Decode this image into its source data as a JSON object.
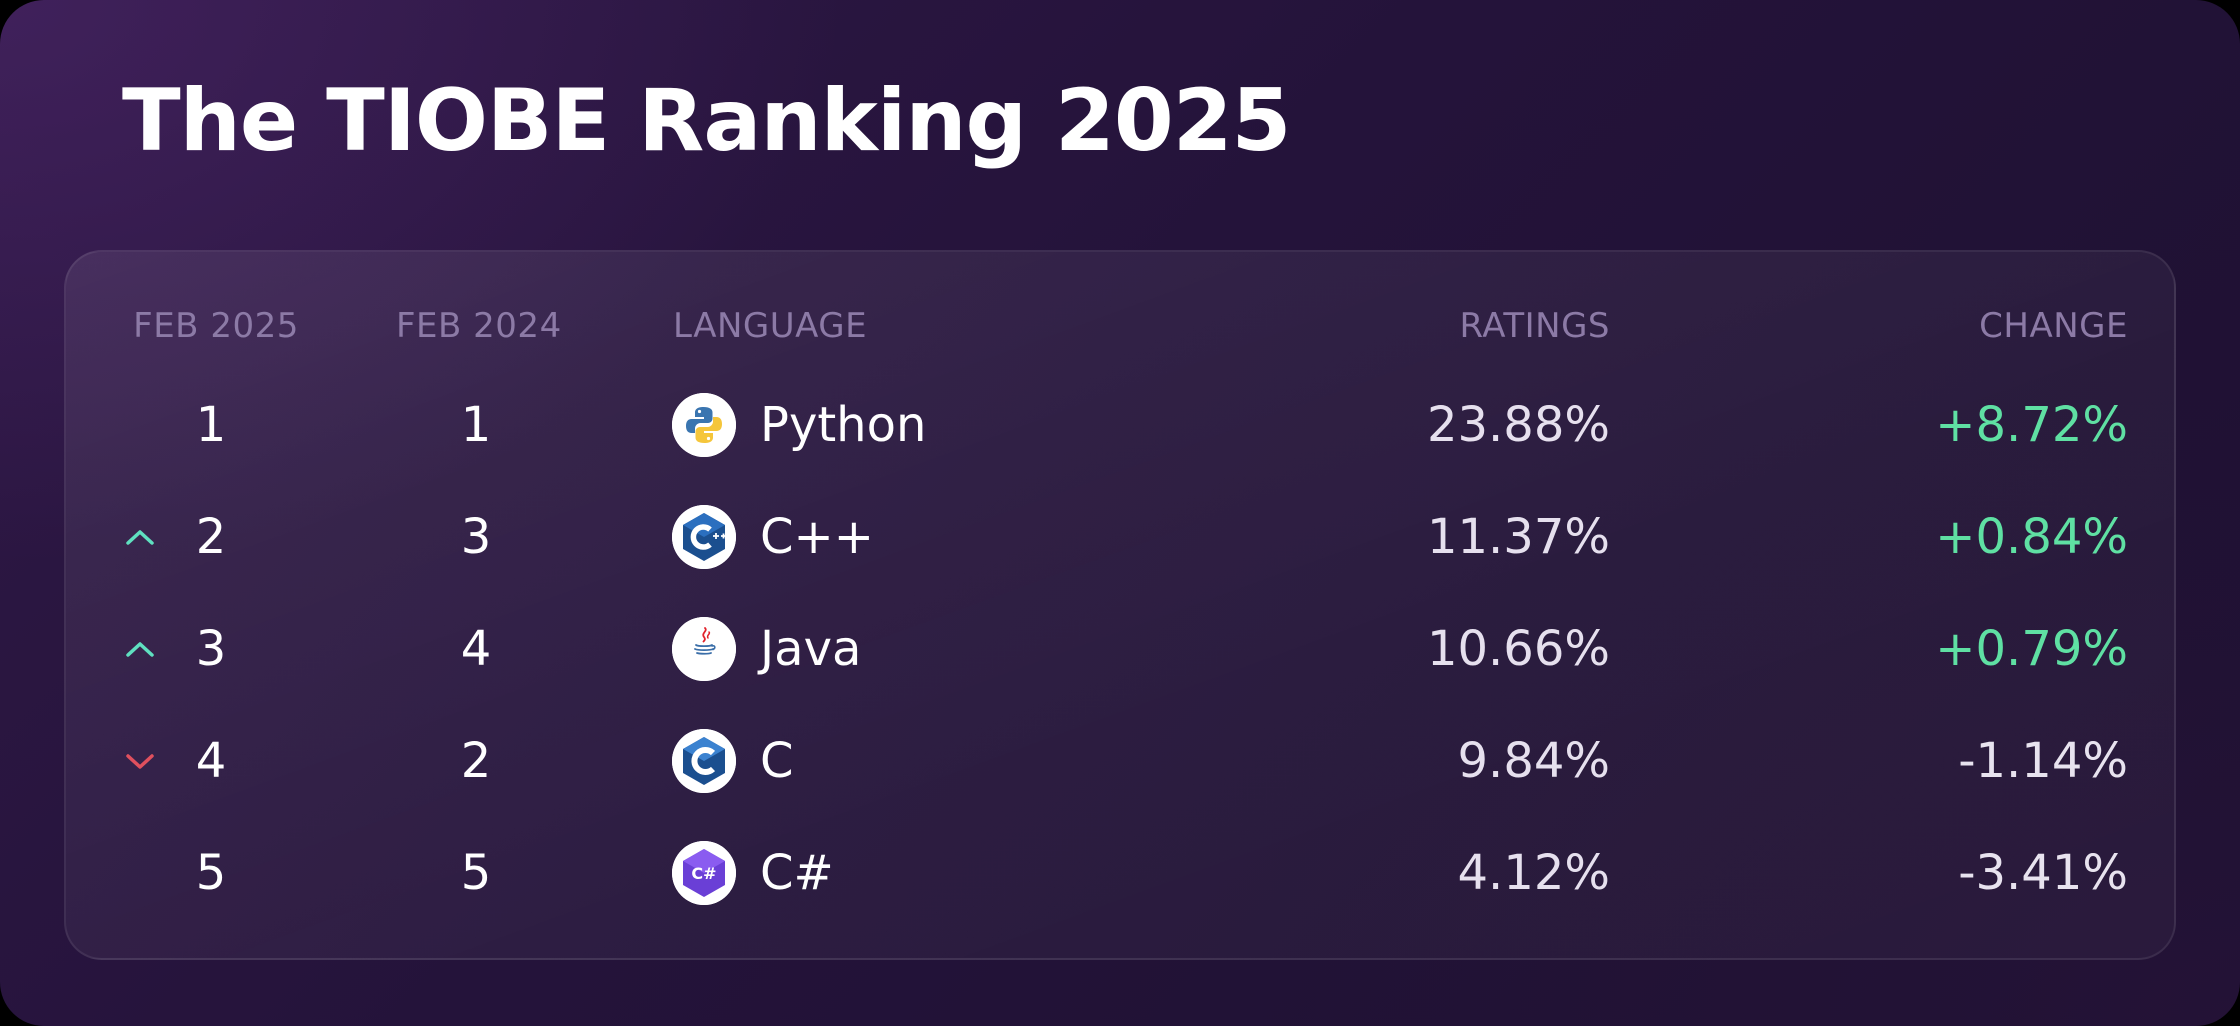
{
  "title": "The TIOBE Ranking 2025",
  "table": {
    "headers": {
      "rank_now": "FEB 2025",
      "rank_prev": "FEB 2024",
      "language": "LANGUAGE",
      "ratings": "RATINGS",
      "change": "CHANGE"
    },
    "rows": [
      {
        "rank_now": "1",
        "rank_prev": "1",
        "trend": "none",
        "language": "Python",
        "icon": "python-icon",
        "rating": "23.88%",
        "change": "+8.72%",
        "change_sign": "positive"
      },
      {
        "rank_now": "2",
        "rank_prev": "3",
        "trend": "up",
        "language": "C++",
        "icon": "cplusplus-icon",
        "rating": "11.37%",
        "change": "+0.84%",
        "change_sign": "positive"
      },
      {
        "rank_now": "3",
        "rank_prev": "4",
        "trend": "up",
        "language": "Java",
        "icon": "java-icon",
        "rating": "10.66%",
        "change": "+0.79%",
        "change_sign": "positive"
      },
      {
        "rank_now": "4",
        "rank_prev": "2",
        "trend": "down",
        "language": "C",
        "icon": "c-icon",
        "rating": "9.84%",
        "change": "-1.14%",
        "change_sign": "negative"
      },
      {
        "rank_now": "5",
        "rank_prev": "5",
        "trend": "none",
        "language": "C#",
        "icon": "csharp-icon",
        "rating": "4.12%",
        "change": "-3.41%",
        "change_sign": "negative"
      }
    ]
  },
  "colors": {
    "positive_change": "#5fe0a3",
    "negative_change": "#e8e3ef",
    "trend_up": "#5fe0c0",
    "trend_down": "#e0505e",
    "header_text": "#8c7aa6"
  }
}
